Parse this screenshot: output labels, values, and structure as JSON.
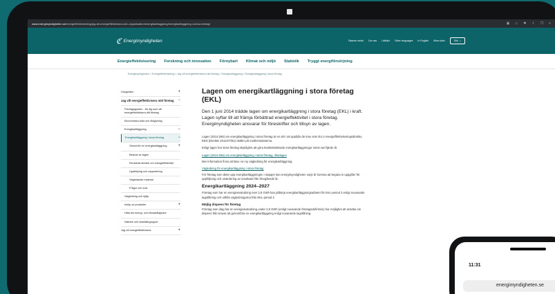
{
  "browser": {
    "url_domain": "www.energimyndigheten.se",
    "url_path": "/energieffektivisering/jag-vill-energieffektivisera-min-organisation/energikartlaggning/energikartlaggning-i-stora-foretag/"
  },
  "site": {
    "logo_text": "Energimyndigheten",
    "utility": [
      "Talande webb",
      "Om oss",
      "Lättläst",
      "Other languages",
      "In English",
      "Mina sidor"
    ],
    "search_label": "Sök"
  },
  "nav": [
    "Energieffektivisering",
    "Forskning och innovation",
    "Förnybart",
    "Klimat och miljö",
    "Statistik",
    "Tryggt energiförsörjning"
  ],
  "breadcrumb": "Energimyndigheten  >  Energieffektivisering  >  Jag vill energieffektivisera mitt företag  >  Energikartläggning  >  Energikartläggning i stora företag",
  "sidebar": [
    {
      "label": "Husguiden",
      "sign": "+",
      "level": 1,
      "bold": false
    },
    {
      "label": "Jag vill energieffektivisera mitt företag",
      "sign": "−",
      "level": 1,
      "bold": true
    },
    {
      "label": "Företagsguiden - för dig som vill energieffektivisera ditt företag",
      "sign": "",
      "level": 2,
      "bold": false
    },
    {
      "label": "Ekonomiska stöd och rådgivning",
      "sign": "",
      "level": 2,
      "bold": false
    },
    {
      "label": "Energikartläggning",
      "sign": "−",
      "level": 2,
      "bold": false
    },
    {
      "label": "Energikartläggning i stora företag",
      "sign": "−",
      "level": 2,
      "bold": false,
      "active": true
    },
    {
      "label": "Genomför en energikartläggning",
      "sign": "+",
      "level": 3,
      "bold": false
    },
    {
      "label": "Besluta av lagen",
      "sign": "",
      "level": 3,
      "bold": false
    },
    {
      "label": "Reviderat direktiv om energieffektivitet",
      "sign": "",
      "level": 3,
      "bold": false
    },
    {
      "label": "Uppföljning och rapportering",
      "sign": "",
      "level": 3,
      "bold": false
    },
    {
      "label": "Vägledande material",
      "sign": "",
      "level": 3,
      "bold": false
    },
    {
      "label": "Frågor och svar",
      "sign": "",
      "level": 3,
      "bold": false
    },
    {
      "label": "Vägledning och hjälp",
      "sign": "",
      "level": 2,
      "bold": false
    },
    {
      "label": "Inköp av produkter",
      "sign": "+",
      "level": 2,
      "bold": false
    },
    {
      "label": "Hitta din energi- och klimatrådgivare",
      "sign": "",
      "level": 2,
      "bold": false
    },
    {
      "label": "Nätverk och beställargrupper",
      "sign": "",
      "level": 2,
      "bold": false
    },
    {
      "label": "Jag vill energieffektivisera",
      "sign": "+",
      "level": 1,
      "bold": false
    }
  ],
  "article": {
    "title": "Lagen om energikartläggning i stora företag (EKL)",
    "lead": "Den 1 juni 2014 trädde lagen om energikartläggning i stora företag (EKL) i kraft. Lagen syftar till att främja förbättrad energieffektivitet i stora företag. Energimyndigheten ansvarar för föreskrifter och tillsyn av lagen.",
    "p1": "Lagen (2014:266) om energikartläggning i stora företag är en del i att uppfylla de krav som EU:s energieffektiviseringsdirektiv, EED (Direktiv 2012/27/EU) ställer på medlemsstaterna.",
    "p2": "Enligt lagen har stora företag skyldighet att göra kvalitetssäkrade energikartläggningar minst vart fjärde år.",
    "link1": "Lagen (2014:266) om energikartläggning i stora företag, riksdagen",
    "p3": "Mer information finns att läsa i en ny vägledning för energikartläggning.",
    "link2": "Vägledning för energikartläggning i stora företag",
    "p4": "För företag som delar upp energikartläggningen i etapper kan energimyndigheten varje år komma att begära in uppgifter för uppföljning och utvärdering av resultatet från föregående år.",
    "h2": "Energikartläggning 2024–2027",
    "p5": "Företag som har en energianvändning över 2,8 GWh kan påbörja energikartläggningsarbetet för EKL-period 3 enligt nuvarande tagstiftning och utifrån vägledningarna från EKL-period 2.",
    "h3": "Möjlig dispens för företag",
    "p6": "Företag som idag har en energianvändning under 2,8 GWh (enligt nuvarande företagsdefinition) har möjlighet att ansöka om dispens från kravet att genomföra en energikartläggning enligt nuvarande lagstiftning."
  },
  "phone": {
    "time": "11:31",
    "url": "energimyndigheten.se"
  }
}
